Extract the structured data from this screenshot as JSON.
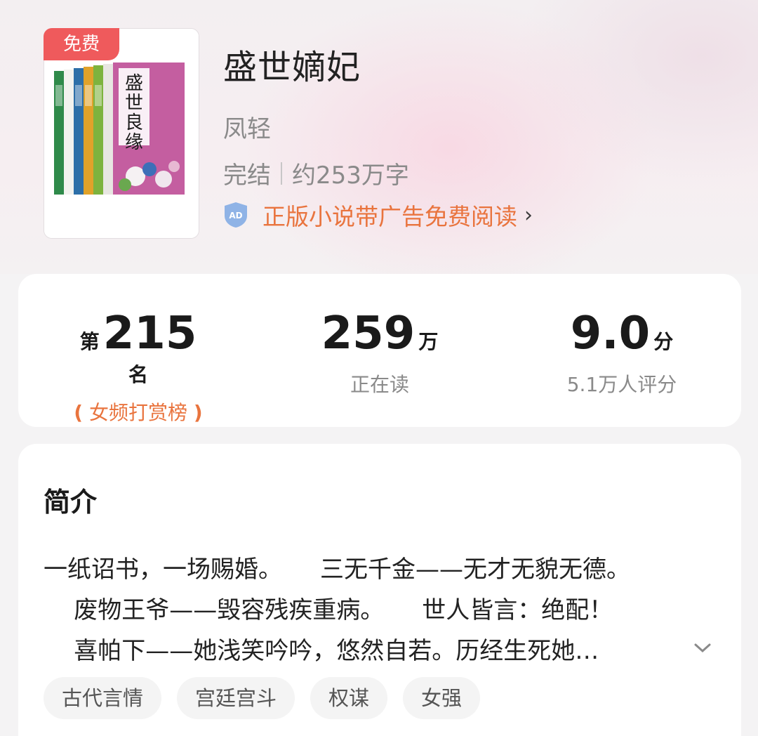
{
  "book": {
    "free_badge": "免费",
    "title": "盛世嫡妃",
    "author": "凤轻",
    "status": "完结",
    "word_count": "约253万字",
    "ad_notice": "正版小说带广告免费阅读",
    "ad_icon_text": "AD",
    "cover_title_art": "盛世良缘"
  },
  "stats": {
    "rank": {
      "prefix": "第",
      "value": "215",
      "suffix": "名",
      "label": "女频打赏榜"
    },
    "readers": {
      "value": "259",
      "suffix": "万",
      "label": "正在读"
    },
    "score": {
      "value": "9.0",
      "suffix": "分",
      "label": "5.1万人评分"
    }
  },
  "intro": {
    "heading": "简介",
    "lines": [
      "一纸诏书，一场赐婚。     三无千金——无才无貌无德。",
      "    废物王爷——毁容残疾重病。     世人皆言：绝配！",
      "    喜帕下——她浅笑吟吟，悠然自若。历经生死她…"
    ]
  },
  "tags": [
    "古代言情",
    "宫廷宫斗",
    "权谋",
    "女强"
  ],
  "colors": {
    "accent_orange": "#e9743e",
    "free_red": "#ef5a5c",
    "ad_blue": "#8fb3e6"
  }
}
